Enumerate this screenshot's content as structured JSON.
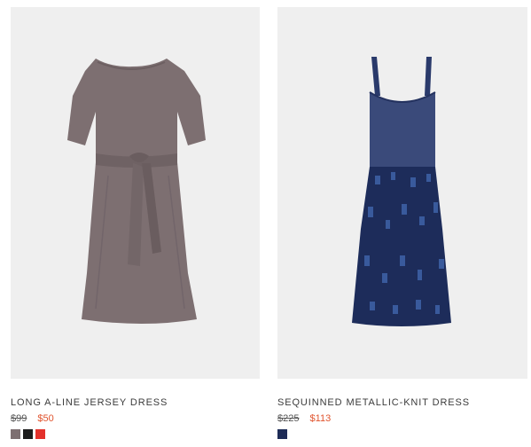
{
  "products": [
    {
      "name": "LONG A-LINE JERSEY DRESS",
      "original_price": "$99",
      "sale_price": "$50",
      "image_background": "#efefef",
      "dress_color": "#7d6f71",
      "swatches": [
        {
          "color": "#7d6f71",
          "label": "grey-brown"
        },
        {
          "color": "#1c1c1c",
          "label": "black"
        },
        {
          "color": "#e3312b",
          "label": "red"
        }
      ]
    },
    {
      "name": "SEQUINNED METALLIC-KNIT DRESS",
      "original_price": "$225",
      "sale_price": "$113",
      "image_background": "#efefef",
      "dress_color": "#2a3a6b",
      "swatches": [
        {
          "color": "#1e2c57",
          "label": "navy"
        }
      ]
    }
  ],
  "colors": {
    "sale_price": "#e0542e",
    "text": "#3b3b3b"
  }
}
